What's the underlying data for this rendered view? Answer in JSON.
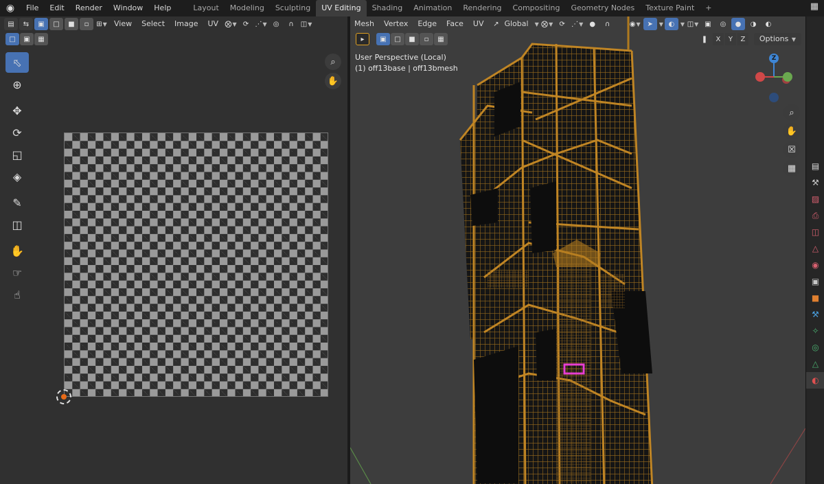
{
  "topbar": {
    "menu": [
      "File",
      "Edit",
      "Render",
      "Window",
      "Help"
    ],
    "tabs": [
      "Layout",
      "Modeling",
      "Sculpting",
      "UV Editing",
      "Shading",
      "Animation",
      "Rendering",
      "Compositing",
      "Geometry Nodes",
      "Texture Paint"
    ],
    "active_tab": "UV Editing"
  },
  "uv_editor": {
    "menus": [
      "View",
      "Select",
      "Image",
      "UV"
    ],
    "tools": [
      "select-box-icon",
      "cursor-icon",
      "move-icon",
      "rotate-icon",
      "scale-icon",
      "transform-icon",
      "annotate-icon",
      "rip-region-icon",
      "grab-icon",
      "relax-icon",
      "pinch-icon"
    ]
  },
  "viewport": {
    "menus": [
      "Mesh",
      "Vertex",
      "Edge",
      "Face",
      "UV"
    ],
    "transform_orientation": "Global",
    "overlay_line1": "User Perspective (Local)",
    "overlay_line2": "(1) off13base | off13bmesh",
    "axes": [
      "X",
      "Y",
      "Z"
    ],
    "options_label": "Options",
    "gizmo_label": "Z",
    "colors": {
      "wire": "#b07a1e",
      "selected": "#e83fd1",
      "axis_x": "#d04848",
      "axis_y": "#6aa84f",
      "axis_z": "#3e86d6"
    }
  }
}
